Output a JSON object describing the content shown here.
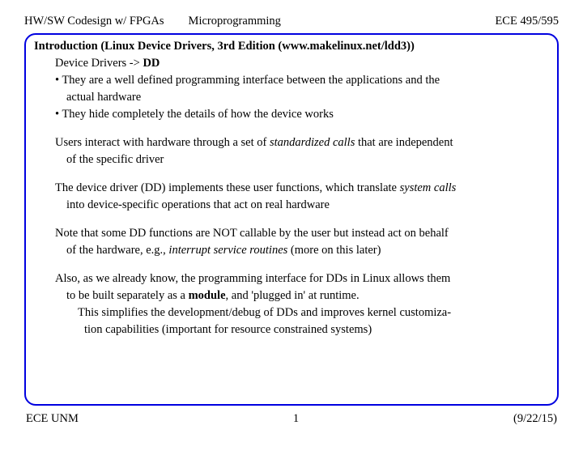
{
  "header": {
    "course": "HW/SW Codesign w/ FPGAs",
    "topic": "Microprogramming",
    "code": "ECE 495/595"
  },
  "title": "Introduction (Linux Device Drivers, 3rd Edition (www.makelinux.net/ldd3))",
  "dd_line_pre": "Device Drivers -> ",
  "dd_bold": "DD",
  "bullet1a": "• They are a well defined programming interface between the applications and the",
  "bullet1b": "actual hardware",
  "bullet2": "• They hide completely the details of how the device works",
  "p1a_pre": "Users interact with hardware through a set of ",
  "p1a_ital": "standardized calls",
  "p1a_post": " that are independent",
  "p1b": "of the specific driver",
  "p2a_pre": "The device driver (DD) implements these user functions, which translate ",
  "p2a_ital": "system calls",
  "p2b": "into device-specific operations that act on real hardware",
  "p3a": "Note that some DD functions are NOT callable by the user but instead act on behalf",
  "p3b_pre": "of the hardware, e.g., ",
  "p3b_ital": "interrupt service routines",
  "p3b_post": " (more on this later)",
  "p4a": "Also, as we already know, the programming interface for DDs in Linux allows them",
  "p4b_pre": "to be built separately as a ",
  "p4b_bold": "module",
  "p4b_post": ", and 'plugged in' at runtime.",
  "p4c": "This simplifies the development/debug of DDs and improves kernel customiza-",
  "p4d": "tion capabilities (important for resource constrained systems)",
  "footer": {
    "left": "ECE UNM",
    "page": "1",
    "date": "(9/22/15)"
  }
}
